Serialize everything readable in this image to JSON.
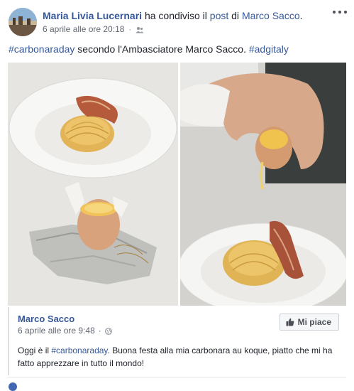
{
  "header": {
    "author": "Maria Livia Lucernari",
    "action": " ha condiviso il ",
    "post_link": "post",
    "of_text": " di ",
    "original_author": "Marco Sacco",
    "period": ".",
    "timestamp": "6 aprile alle ore 20:18",
    "separator": "·",
    "audience_icon": "friends-icon",
    "more_icon": "more-options-icon"
  },
  "post": {
    "hashtag1": "#carbonaraday",
    "text": " secondo l'Ambasciatore Marco Sacco. ",
    "hashtag2": "#adgitaly"
  },
  "photos": [
    {
      "alt": "spaghetti carbonara nest with crispy guanciale and egg yolk in egg carton"
    },
    {
      "alt": "hand pouring egg yolk over spaghetti with guanciale"
    }
  ],
  "shared": {
    "author": "Marco Sacco",
    "timestamp": "6 aprile alle ore 9:48",
    "separator": "·",
    "audience_icon": "globe-icon",
    "like_label": "Mi piace",
    "text_before": "Oggi è il ",
    "hashtag": "#carbonaraday",
    "text_after": ". Buona festa alla mia carbonara au koque, piatto che mi ha fatto apprezzare in tutto il mondo!"
  },
  "colors": {
    "link": "#365899",
    "text": "#1d2129",
    "meta": "#616770"
  }
}
